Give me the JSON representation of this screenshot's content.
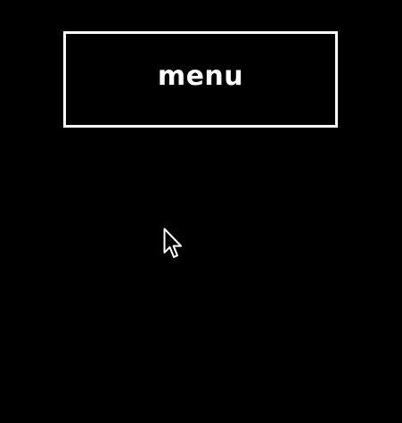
{
  "screen": {
    "background": "#000000"
  },
  "menu_button": {
    "label": "menu",
    "text_color": "#ffffff",
    "border_color": "#ffffff"
  },
  "cursor": {
    "icon": "arrow-pointer-icon",
    "fill": "#000000",
    "stroke": "#ffffff"
  }
}
